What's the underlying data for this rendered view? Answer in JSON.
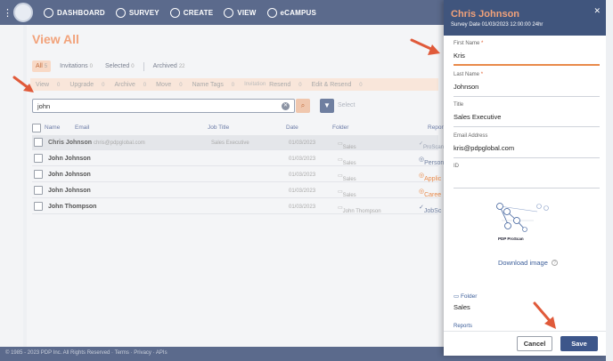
{
  "topbar": {
    "menu_glyph": "⋮",
    "nav": [
      {
        "label": "DASHBOARD",
        "icon": "dashboard-icon"
      },
      {
        "label": "SURVEY",
        "icon": "checkmark-icon"
      },
      {
        "label": "CREATE",
        "icon": "plus-circle-icon"
      },
      {
        "label": "VIEW",
        "icon": "eye-icon"
      },
      {
        "label": "eCAMPUS",
        "icon": "graduation-cap-icon"
      }
    ]
  },
  "page": {
    "title": "View All",
    "tabs": [
      {
        "label": "All",
        "count": "5"
      },
      {
        "label": "Invitations",
        "count": "0"
      },
      {
        "label": "Selected",
        "count": "0"
      },
      {
        "label": "Archived",
        "count": "22"
      }
    ],
    "actions": [
      {
        "label": "View",
        "count": "0"
      },
      {
        "label": "Upgrade",
        "count": "0"
      },
      {
        "label": "Archive",
        "count": "0"
      },
      {
        "label": "Move",
        "count": "0"
      },
      {
        "label": "Name Tags",
        "count": "0"
      },
      {
        "label": "Invitation",
        "count": ""
      },
      {
        "label": "Resend",
        "count": "0"
      },
      {
        "label": "Edit & Resend",
        "count": "0"
      }
    ],
    "search": {
      "value": "john",
      "clear_glyph": "✕",
      "search_glyph": "⌕",
      "filter_glyph": "▼",
      "select_placeholder": "Select"
    },
    "table": {
      "headers": {
        "name": "Name",
        "email": "Email",
        "job_title": "Job Title",
        "date": "Date",
        "folder": "Folder",
        "report": "Report"
      },
      "rows": [
        {
          "name": "Chris Johnson",
          "email": "chris@pdpglobal.com",
          "job": "Sales Executive",
          "date": "01/03/2023",
          "folder": "Sales",
          "report": "ProScan",
          "report_color": "#9aa3b4"
        },
        {
          "name": "John Johnson",
          "email": "",
          "job": "",
          "date": "01/03/2023",
          "folder": "Sales",
          "report": "Person",
          "report_color": "#6f7fa0"
        },
        {
          "name": "John Johnson",
          "email": "",
          "job": "",
          "date": "01/03/2023",
          "folder": "Sales",
          "report": "Applic",
          "report_color": "#e98a4a"
        },
        {
          "name": "John Johnson",
          "email": "",
          "job": "",
          "date": "01/03/2023",
          "folder": "Sales",
          "report": "Caree",
          "report_color": "#e98a4a"
        },
        {
          "name": "John Thompson",
          "email": "",
          "job": "",
          "date": "01/03/2023",
          "folder": "John Thompson",
          "report": "JobSc",
          "report_color": "#6f7fa0"
        }
      ]
    },
    "footer": "© 1985 - 2023 PDP Inc. All Rights Reserved · Terms · Privacy · APIs"
  },
  "drawer": {
    "title": "Chris Johnson",
    "subtitle": "Survey Date 01/03/2023 12:00:00 24hr",
    "close_glyph": "✕",
    "fields": [
      {
        "label": "First Name",
        "required": "*",
        "value": "Kris"
      },
      {
        "label": "Last Name",
        "required": "*",
        "value": "Johnson"
      },
      {
        "label": "Title",
        "required": "",
        "value": "Sales Executive"
      },
      {
        "label": "Email Address",
        "required": "",
        "value": "kris@pdpglobal.com"
      },
      {
        "label": "ID",
        "required": "",
        "value": ""
      }
    ],
    "image_caption": "PDP ProScan",
    "download_label": "Download image",
    "folder_label": "Folder",
    "folder_value": "Sales",
    "reports_label": "Reports",
    "cancel_label": "Cancel",
    "save_label": "Save",
    "accent": "#e98a4a",
    "header_color": "#40557d"
  }
}
